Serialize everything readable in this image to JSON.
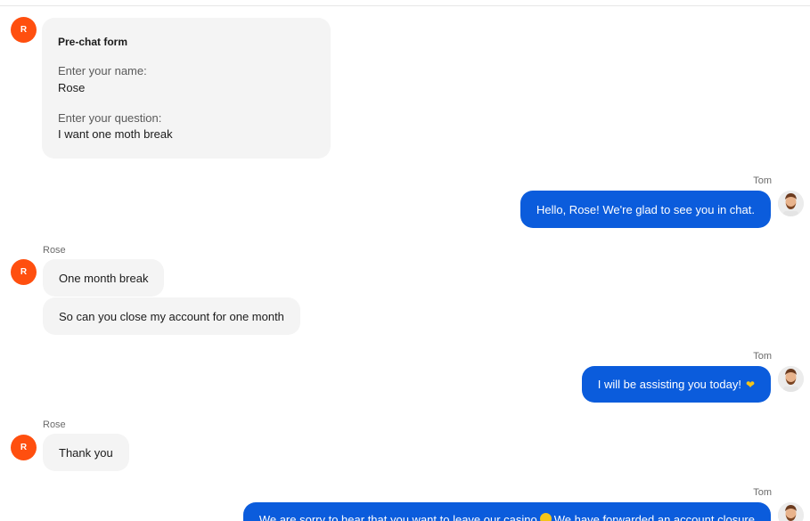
{
  "agent": {
    "name": "Tom"
  },
  "visitor": {
    "name": "Rose",
    "initial": "R"
  },
  "prechat": {
    "title": "Pre-chat form",
    "name_label": "Enter your name:",
    "name_value": "Rose",
    "question_label": "Enter your question:",
    "question_value": "I want one moth break"
  },
  "messages": {
    "tom_greeting": "Hello, Rose! We're glad to see you in chat.",
    "rose_1": "One month break",
    "rose_2": "So can you close my account for one month",
    "tom_assist": "I will be assisting you today!",
    "rose_3": "Thank you",
    "tom_sorry_a": "We are sorry to hear that you want to leave our casino",
    "tom_sorry_b": "We have forwarded an account closure"
  },
  "colors": {
    "visitor_avatar": "#ff4f0f",
    "agent_bubble": "#0b5cdc",
    "visitor_bubble": "#f4f4f4"
  },
  "icons": {
    "agent_avatar": "bearded-man-avatar-icon",
    "assist_emoji": "yellow-heart-hands-emoji",
    "sorry_emoji": "sad-face-emoji"
  }
}
